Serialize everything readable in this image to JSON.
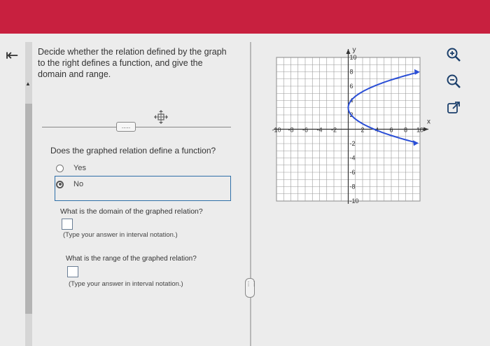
{
  "question": {
    "prompt": "Decide whether the relation defined by the graph to the right defines a function, and give the domain and range.",
    "expand_dots": "....."
  },
  "part1": {
    "question": "Does the graphed relation define a function?",
    "options": [
      {
        "label": "Yes",
        "selected": false
      },
      {
        "label": "No",
        "selected": true
      }
    ]
  },
  "part2": {
    "question": "What is the domain of the graphed relation?",
    "note": "(Type your answer in interval notation.)"
  },
  "part3": {
    "question": "What is the range of the graphed relation?",
    "note": "(Type your answer in interval notation.)"
  },
  "graph": {
    "x_axis_label": "x",
    "y_axis_label": "y",
    "x_range": [
      -10,
      10
    ],
    "y_range": [
      -10,
      10
    ],
    "x_tick_labels": [
      "-10",
      "-8",
      "-6",
      "-4",
      "-2",
      "2",
      "4",
      "6",
      "8",
      "10"
    ],
    "y_tick_labels": [
      "10",
      "8",
      "6",
      "4",
      "2",
      "-2",
      "-4",
      "-6",
      "-8",
      "-10"
    ],
    "curve_color": "#2b4fd6",
    "curve": {
      "type": "sideways-parabola",
      "vertex": [
        0,
        3
      ],
      "arrows_toward": "right"
    }
  },
  "toolbar": {
    "icons": [
      "zoom-in-icon",
      "zoom-out-icon",
      "popout-icon"
    ]
  },
  "colors": {
    "header": "#c8203f",
    "selection_border": "#2e6fa8"
  }
}
